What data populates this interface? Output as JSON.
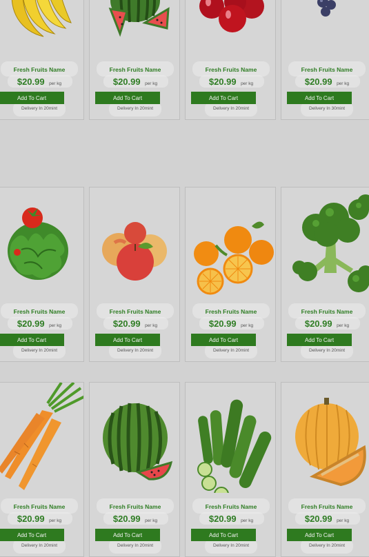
{
  "colors": {
    "page_bg": "#d2d2d2",
    "accent_green": "#2e7a1f",
    "price_green": "#2f7d24"
  },
  "products": [
    {
      "image": "banana-icon",
      "name": "Fresh Fruits Name",
      "price": "$20.99",
      "unit": "per kg",
      "button": "Add To Cart",
      "delivery": "Delivery In 20mint"
    },
    {
      "image": "watermelon-slices-icon",
      "name": "Fresh Fruits Name",
      "price": "$20.99",
      "unit": "per kg",
      "button": "Add To Cart",
      "delivery": "Delivery In 20mint"
    },
    {
      "image": "cherries-icon",
      "name": "Fresh Fruits Name",
      "price": "$20.99",
      "unit": "per kg",
      "button": "Add To Cart",
      "delivery": "Delivery In 20mint"
    },
    {
      "image": "grapes-icon",
      "name": "Fresh Fruits Name",
      "price": "$20.99",
      "unit": "per kg",
      "button": "Add To Cart",
      "delivery": "Delivery In 30mint"
    },
    {
      "image": "lettuce-tomato-icon",
      "name": "Fresh Fruits Name",
      "price": "$20.99",
      "unit": "per kg",
      "button": "Add To Cart",
      "delivery": "Delivery In 20mint"
    },
    {
      "image": "apples-icon",
      "name": "Fresh Fruits Name",
      "price": "$20.99",
      "unit": "per kg",
      "button": "Add To Cart",
      "delivery": "Delivery In 20mint"
    },
    {
      "image": "oranges-icon",
      "name": "Fresh Fruits Name",
      "price": "$20.99",
      "unit": "per kg",
      "button": "Add To Cart",
      "delivery": "Delivery In 20mint"
    },
    {
      "image": "broccoli-icon",
      "name": "Fresh Fruits Name",
      "price": "$20.99",
      "unit": "per kg",
      "button": "Add To Cart",
      "delivery": "Delivery In 20mint"
    },
    {
      "image": "carrots-icon",
      "name": "Fresh Fruits Name",
      "price": "$20.99",
      "unit": "per kg",
      "button": "Add To Cart",
      "delivery": "Delivery In 20mint"
    },
    {
      "image": "watermelon-whole-icon",
      "name": "Fresh Fruits Name",
      "price": "$20.99",
      "unit": "per kg",
      "button": "Add To Cart",
      "delivery": "Delivery In 20mint"
    },
    {
      "image": "cucumbers-icon",
      "name": "Fresh Fruits Name",
      "price": "$20.99",
      "unit": "per kg",
      "button": "Add To Cart",
      "delivery": "Delivery In 20mint"
    },
    {
      "image": "melon-icon",
      "name": "Fresh Fruits Name",
      "price": "$20.99",
      "unit": "per kg",
      "button": "Add To Cart",
      "delivery": "Delivery In 20mint"
    }
  ]
}
